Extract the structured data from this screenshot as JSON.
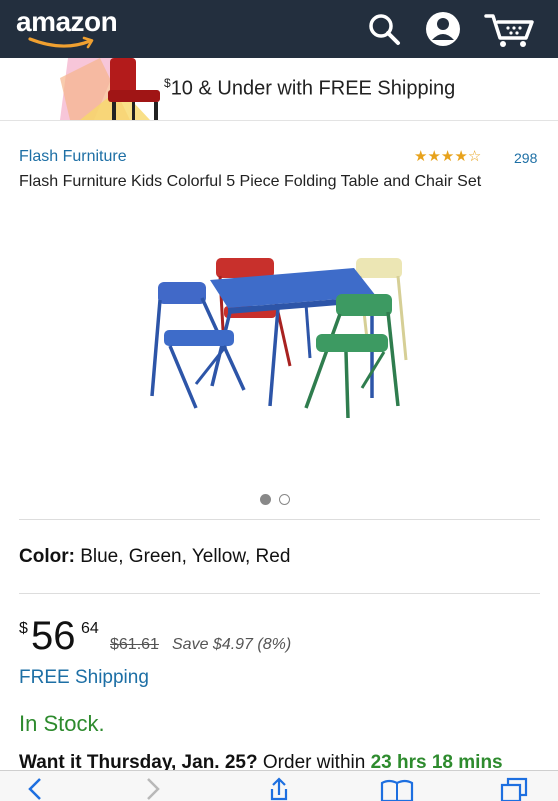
{
  "header": {
    "logo": "amazon",
    "icons": [
      "search-icon",
      "account-icon",
      "cart-icon"
    ],
    "background": "#232f3e"
  },
  "banner": {
    "currency": "$",
    "text": "10 & Under with FREE Shipping"
  },
  "product": {
    "brand": "Flash Furniture",
    "rating_stars": 4,
    "rating_max": 5,
    "review_count": "298",
    "title": "Flash Furniture Kids Colorful 5 Piece Folding Table and Chair Set",
    "image_pager": {
      "count": 2,
      "active": 0
    }
  },
  "color": {
    "label": "Color:",
    "value": "Blue, Green, Yellow, Red"
  },
  "price": {
    "currency": "$",
    "whole": "56",
    "fraction": "64",
    "list_price": "$61.61",
    "savings": "Save $4.97 (8%)"
  },
  "shipping": "FREE Shipping",
  "stock": "In Stock.",
  "delivery": {
    "prefix": "Want it Thursday, Jan. 25?",
    "middle": "Order within",
    "countdown": "23 hrs 18 mins"
  },
  "bottom_toolbar": {
    "icons": [
      "back-icon",
      "forward-icon",
      "share-icon",
      "bookmarks-icon",
      "tabs-icon"
    ]
  },
  "colors": {
    "link": "#1d6fa5",
    "in_stock": "#2e8b2e",
    "star": "#e7a21c"
  }
}
